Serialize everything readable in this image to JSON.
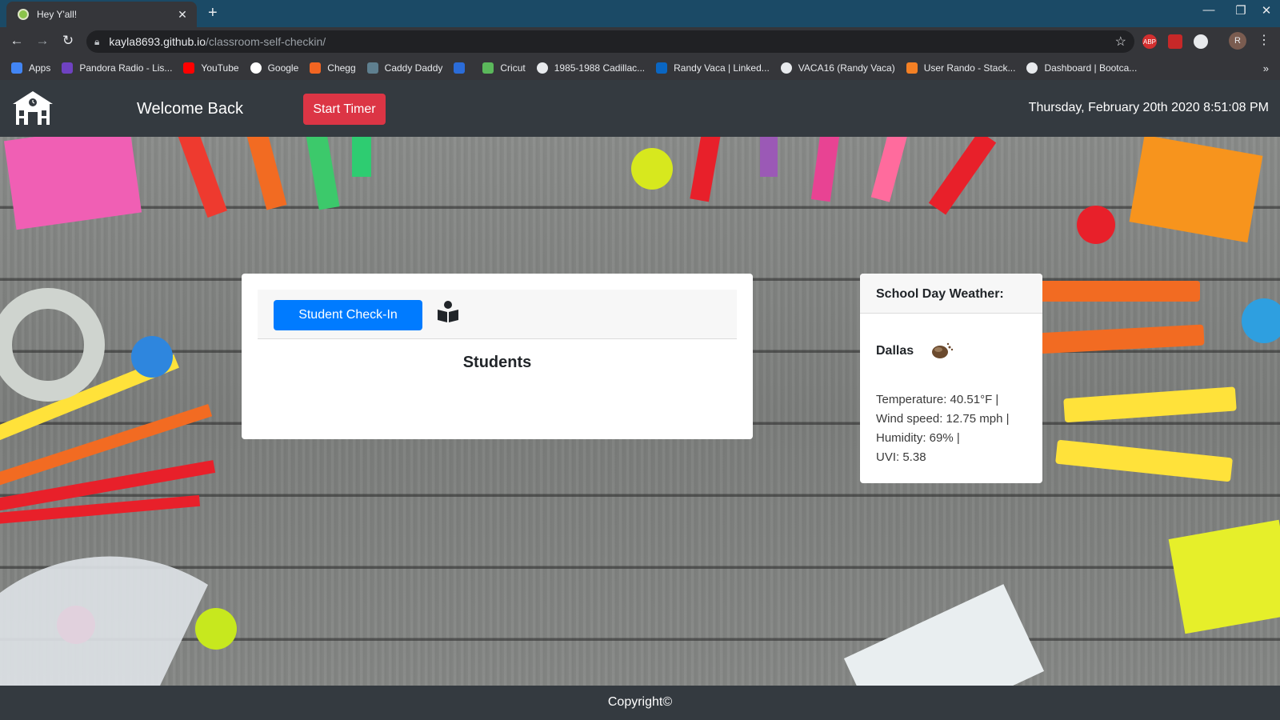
{
  "browser": {
    "tab_title": "Hey Y'all!",
    "tab_close": "✕",
    "new_tab": "+",
    "url_host": "kayla8693.github.io",
    "url_path": "/classroom-self-checkin/",
    "avatar_initial": "R",
    "extension_abp": "ABP",
    "window_min": "—",
    "window_restore": "❐",
    "window_close": "✕",
    "bookmarks": [
      {
        "label": "Apps",
        "icon": "apps-grid-icon",
        "color": "#4285f4"
      },
      {
        "label": "Pandora Radio - Lis...",
        "icon": "pandora-icon",
        "color": "#6f42c1"
      },
      {
        "label": "YouTube",
        "icon": "youtube-icon",
        "color": "#ff0000"
      },
      {
        "label": "Google",
        "icon": "google-icon",
        "color": "#ffffff"
      },
      {
        "label": "Chegg",
        "icon": "chegg-icon",
        "color": "#f26522"
      },
      {
        "label": "Caddy Daddy",
        "icon": "caddy-icon",
        "color": "#5f7f8f"
      },
      {
        "label": "",
        "icon": "w-icon",
        "color": "#2b6cd8"
      },
      {
        "label": "Cricut",
        "icon": "cricut-icon",
        "color": "#5bb85b"
      },
      {
        "label": "1985-1988 Cadillac...",
        "icon": "globe-icon",
        "color": "#e8eaed"
      },
      {
        "label": "Randy Vaca | Linked...",
        "icon": "linkedin-icon",
        "color": "#0a66c2"
      },
      {
        "label": "VACA16 (Randy Vaca)",
        "icon": "github-icon",
        "color": "#e8eaed"
      },
      {
        "label": "User Rando - Stack...",
        "icon": "stackoverflow-icon",
        "color": "#f48024"
      },
      {
        "label": "Dashboard | Bootca...",
        "icon": "globe-icon",
        "color": "#e8eaed"
      }
    ],
    "more": "»"
  },
  "nav": {
    "welcome": "Welcome Back",
    "start_timer": "Start Timer",
    "datetime": "Thursday, February 20th 2020 8:51:08 PM"
  },
  "students_card": {
    "checkin_button": "Student Check-In",
    "title": "Students"
  },
  "weather": {
    "header": "School Day Weather:",
    "city": "Dallas",
    "lines": [
      "Temperature: 40.51°F |",
      "Wind speed: 12.75 mph |",
      "Humidity: 69% |",
      "UVI: 5.38"
    ]
  },
  "footer": {
    "copyright": "Copyright©"
  },
  "colors": {
    "navbar": "#343a40",
    "primary": "#007bff",
    "danger": "#dc3545"
  }
}
